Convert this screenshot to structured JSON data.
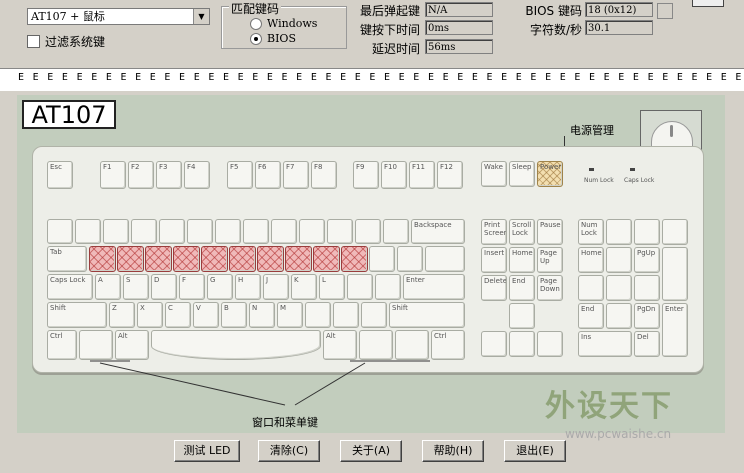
{
  "top": {
    "device_select": "AT107 + 鼠标",
    "filter_label": "过滤系统键",
    "match_group_title": "匹配键码",
    "radio_windows": "Windows",
    "radio_bios": "BIOS",
    "last_key_label": "最后弹起键",
    "last_key_value": "N/A",
    "press_time_label": "键按下时间",
    "press_time_value": "0ms",
    "delay_label": "延迟时间",
    "delay_value": "56ms",
    "bios_code_label": "BIOS 键码",
    "bios_code_value": "18 (0x12)",
    "chars_per_sec_label": "字符数/秒",
    "chars_per_sec_value": "30.1"
  },
  "event_strip": "E E E E E E E E E E E E E E E E E E E E E E E E E E E E E E E E E E E E E E E E E E E E E E E E E E E E E E E E E E E E E E E E E P Y",
  "keyboard": {
    "model": "AT107",
    "power_label": "电源管理",
    "window_menu_label": "窗口和菜单键",
    "keys": {
      "esc": "Esc",
      "f1": "F1",
      "f2": "F2",
      "f3": "F3",
      "f4": "F4",
      "f5": "F5",
      "f6": "F6",
      "f7": "F7",
      "f8": "F8",
      "f9": "F9",
      "f10": "F10",
      "f11": "F11",
      "f12": "F12",
      "wake": "Wake",
      "sleep": "Sleep",
      "power": "Power",
      "backspace": "Backspace",
      "tab": "Tab",
      "capslock": "Caps Lock",
      "enter": "Enter",
      "shift": "Shift",
      "ctrl": "Ctrl",
      "alt": "Alt",
      "a": "A",
      "s": "S",
      "d": "D",
      "f": "F",
      "g": "G",
      "h": "H",
      "j": "J",
      "k": "K",
      "l": "L",
      "z": "Z",
      "x": "X",
      "c": "C",
      "v": "V",
      "b": "B",
      "n": "N",
      "m": "M",
      "prtsc": "Print Screen",
      "scroll": "Scroll Lock",
      "pause": "Pause",
      "insert": "Insert",
      "home": "Home",
      "pgup": "Page Up",
      "delete": "Delete",
      "end": "End",
      "pgdn": "Page Down",
      "numlock": "Num Lock",
      "num_home": "Home",
      "pgup2": "PgUp",
      "num_end": "End",
      "pgdn2": "PgDn",
      "ins": "Ins",
      "del": "Del",
      "num_enter": "Enter",
      "num_lock_led": "Num Lock",
      "caps_lock_led": "Caps Lock"
    }
  },
  "buttons": {
    "test_led": "测试 LED",
    "clear": "清除(C)",
    "about": "关于(A)",
    "help": "帮助(H)",
    "exit": "退出(E)"
  },
  "watermark": {
    "text": "外设天下",
    "url": "www.pcwaishe.cn"
  }
}
